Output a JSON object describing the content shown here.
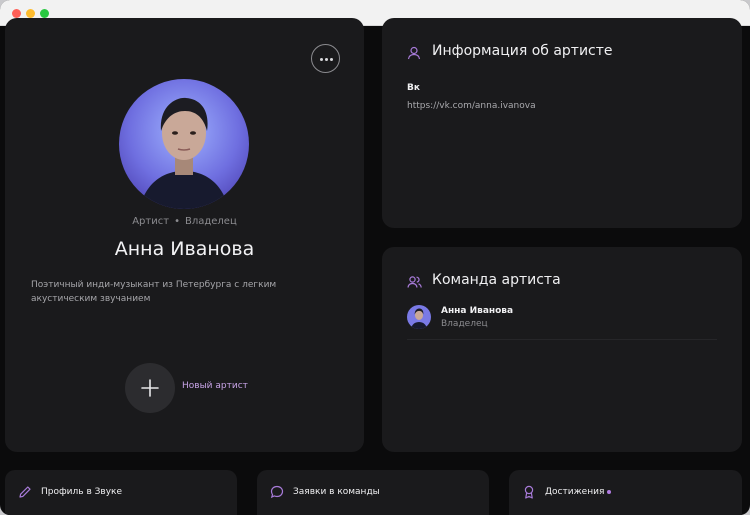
{
  "profile": {
    "roles": [
      "Артист",
      "Владелец"
    ],
    "separator": "•",
    "name": "Анна Иванова",
    "bio": "Поэтичный инди-музыкант из Петербурга с легким акустическим звучанием",
    "new_artist_label": "Новый артист",
    "more_icon": "ellipsis-icon",
    "add_icon": "plus-icon"
  },
  "info": {
    "title": "Информация об артисте",
    "icon": "user-icon",
    "vk_label": "Вк",
    "vk_link": "https://vk.com/anna.ivanova"
  },
  "team": {
    "title": "Команда артиста",
    "icon": "users-icon",
    "members": [
      {
        "name": "Анна Иванова",
        "role": "Владелец"
      }
    ]
  },
  "bottom_nav": [
    {
      "label": "Профиль в Звуке",
      "icon": "pencil-icon"
    },
    {
      "label": "Заявки в команды",
      "icon": "chat-bubble-icon"
    },
    {
      "label": "Достижения",
      "icon": "award-icon",
      "has_indicator": true
    }
  ],
  "colors": {
    "accent": "#b07ce0",
    "card": "#1a1a1c",
    "background": "#0b0b0c"
  }
}
